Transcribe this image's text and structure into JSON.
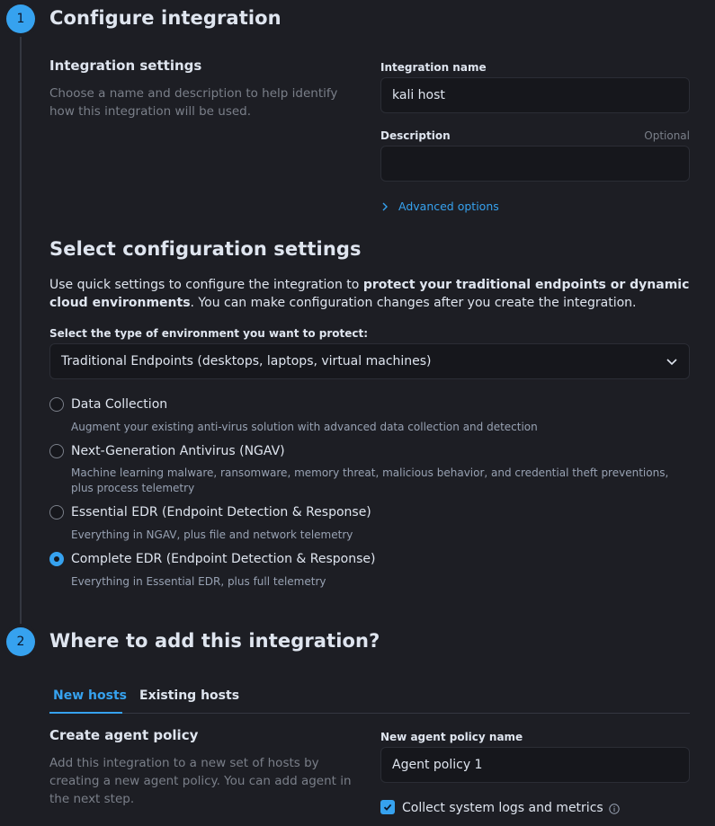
{
  "step1": {
    "number": "1",
    "title": "Configure integration",
    "settings": {
      "title": "Integration settings",
      "description": "Choose a name and description to help identify how this integration will be used."
    },
    "name_field": {
      "label": "Integration name",
      "value": "kali host"
    },
    "description_field": {
      "label": "Description",
      "optional": "Optional",
      "value": ""
    },
    "advanced_options": "Advanced options"
  },
  "config": {
    "title": "Select configuration settings",
    "intro_plain": "Use quick settings to configure the integration to ",
    "intro_bold": "protect your traditional endpoints or dynamic cloud environments",
    "intro_rest": ". You can make configuration changes after you create the integration.",
    "env_label": "Select the type of environment you want to protect:",
    "env_selected": "Traditional Endpoints (desktops, laptops, virtual machines)",
    "options": [
      {
        "label": "Data Collection",
        "desc": "Augment your existing anti-virus solution with advanced data collection and detection",
        "checked": false
      },
      {
        "label": "Next-Generation Antivirus (NGAV)",
        "desc": "Machine learning malware, ransomware, memory threat, malicious behavior, and credential theft preventions, plus process telemetry",
        "checked": false
      },
      {
        "label": "Essential EDR (Endpoint Detection & Response)",
        "desc": "Everything in NGAV, plus file and network telemetry",
        "checked": false
      },
      {
        "label": "Complete EDR (Endpoint Detection & Response)",
        "desc": "Everything in Essential EDR, plus full telemetry",
        "checked": true
      }
    ]
  },
  "step2": {
    "number": "2",
    "title": "Where to add this integration?",
    "tabs": [
      {
        "label": "New hosts",
        "active": true
      },
      {
        "label": "Existing hosts",
        "active": false
      }
    ],
    "policy": {
      "title": "Create agent policy",
      "description": "Add this integration to a new set of hosts by creating a new agent policy. You can add agent in the next step."
    },
    "policy_name_field": {
      "label": "New agent policy name",
      "value": "Agent policy 1"
    },
    "collect_logs": {
      "label": "Collect system logs and metrics",
      "checked": true
    }
  },
  "colors": {
    "accent": "#36a2ef",
    "background": "#1d1e24",
    "input_bg": "#16171c"
  }
}
